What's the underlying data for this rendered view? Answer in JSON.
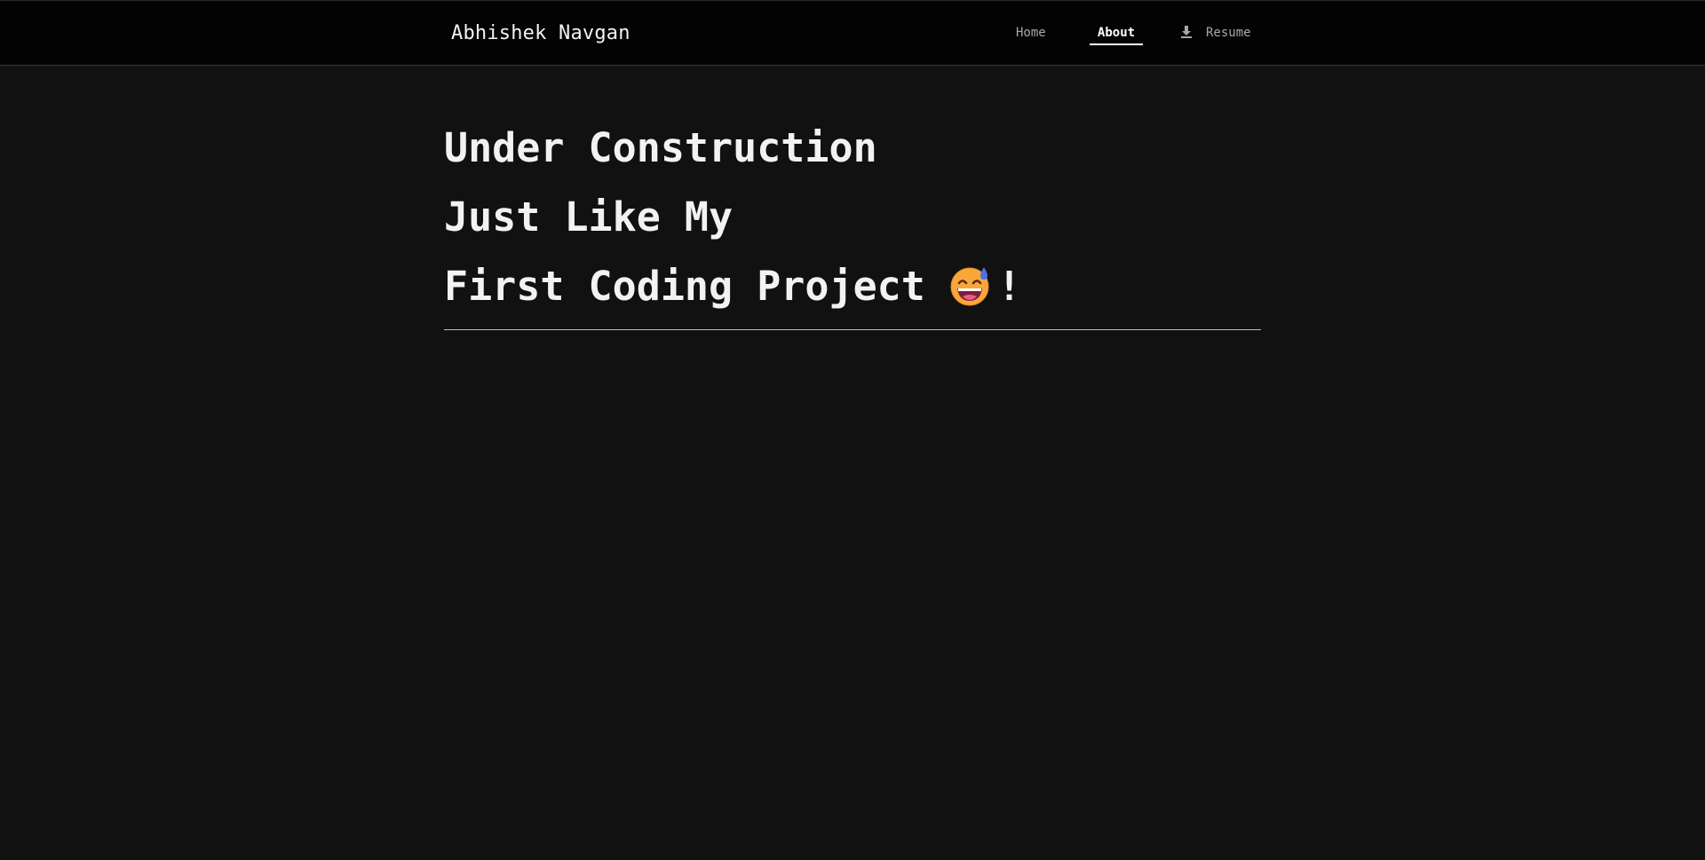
{
  "header": {
    "brand": "Abhishek Navgan",
    "nav": {
      "home": "Home",
      "about": "About",
      "resume": "Resume"
    },
    "active_tab": "About"
  },
  "main": {
    "headline": {
      "line1": "Under Construction",
      "line2": "Just Like My",
      "line3": "First Coding Project",
      "line3_suffix": "!"
    },
    "emoji": "grinning-face-with-sweat-icon"
  },
  "colors": {
    "background": "#111111",
    "header_background": "#030303",
    "text": "#f2f2f2",
    "nav_inactive": "#a8a8a8"
  }
}
